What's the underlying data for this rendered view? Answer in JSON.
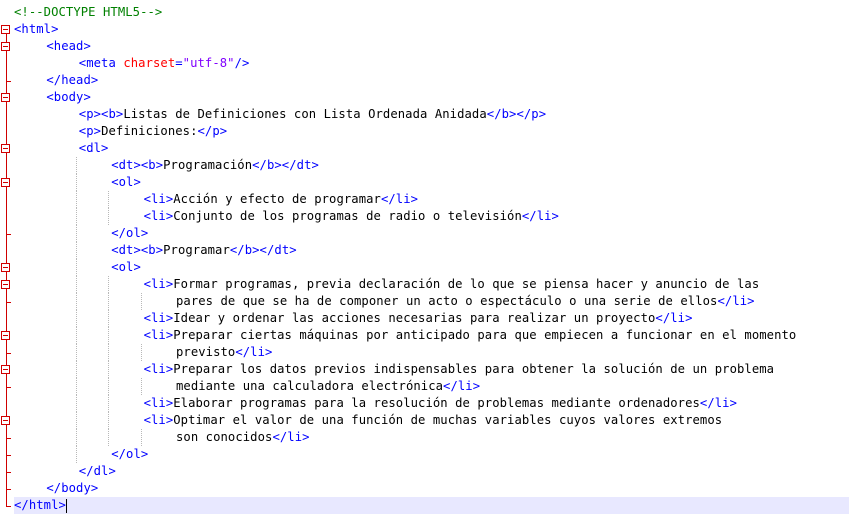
{
  "editor": {
    "language": "html",
    "current_line": 30,
    "lines": [
      {
        "n": 1,
        "indent": 0,
        "tokens": [
          {
            "t": "cmt",
            "v": "<!--DOCTYPE HTML5-->"
          }
        ]
      },
      {
        "n": 2,
        "indent": 0,
        "tokens": [
          {
            "t": "tag",
            "v": "<html>"
          }
        ]
      },
      {
        "n": 3,
        "indent": 1,
        "tokens": [
          {
            "t": "tag",
            "v": "<head>"
          }
        ]
      },
      {
        "n": 4,
        "indent": 2,
        "tokens": [
          {
            "t": "tag",
            "v": "<meta "
          },
          {
            "t": "attr",
            "v": "charset"
          },
          {
            "t": "tag",
            "v": "="
          },
          {
            "t": "val",
            "v": "\"utf-8\""
          },
          {
            "t": "tag",
            "v": "/>"
          }
        ]
      },
      {
        "n": 5,
        "indent": 1,
        "tokens": [
          {
            "t": "tag",
            "v": "</head>"
          }
        ]
      },
      {
        "n": 6,
        "indent": 1,
        "tokens": [
          {
            "t": "tag",
            "v": "<body>"
          }
        ]
      },
      {
        "n": 7,
        "indent": 2,
        "tokens": [
          {
            "t": "tag",
            "v": "<p><b>"
          },
          {
            "t": "txt",
            "v": "Listas de Definiciones con Lista Ordenada Anidada"
          },
          {
            "t": "tag",
            "v": "</b></p>"
          }
        ]
      },
      {
        "n": 8,
        "indent": 2,
        "tokens": [
          {
            "t": "tag",
            "v": "<p>"
          },
          {
            "t": "txt",
            "v": "Definiciones:"
          },
          {
            "t": "tag",
            "v": "</p>"
          }
        ]
      },
      {
        "n": 9,
        "indent": 2,
        "tokens": [
          {
            "t": "tag",
            "v": "<dl>"
          }
        ]
      },
      {
        "n": 10,
        "indent": 3,
        "tokens": [
          {
            "t": "tag",
            "v": "<dt><b>"
          },
          {
            "t": "txt",
            "v": "Programación"
          },
          {
            "t": "tag",
            "v": "</b></dt>"
          }
        ]
      },
      {
        "n": 11,
        "indent": 3,
        "tokens": [
          {
            "t": "tag",
            "v": "<ol>"
          }
        ]
      },
      {
        "n": 12,
        "indent": 4,
        "tokens": [
          {
            "t": "tag",
            "v": "<li>"
          },
          {
            "t": "txt",
            "v": "Acción y efecto de programar"
          },
          {
            "t": "tag",
            "v": "</li>"
          }
        ]
      },
      {
        "n": 13,
        "indent": 4,
        "tokens": [
          {
            "t": "tag",
            "v": "<li>"
          },
          {
            "t": "txt",
            "v": "Conjunto de los programas de radio o televisión"
          },
          {
            "t": "tag",
            "v": "</li>"
          }
        ]
      },
      {
        "n": 14,
        "indent": 3,
        "tokens": [
          {
            "t": "tag",
            "v": "</ol>"
          }
        ]
      },
      {
        "n": 15,
        "indent": 3,
        "tokens": [
          {
            "t": "tag",
            "v": "<dt><b>"
          },
          {
            "t": "txt",
            "v": "Programar"
          },
          {
            "t": "tag",
            "v": "</b></dt>"
          }
        ]
      },
      {
        "n": 16,
        "indent": 3,
        "tokens": [
          {
            "t": "tag",
            "v": "<ol>"
          }
        ]
      },
      {
        "n": 17,
        "indent": 4,
        "tokens": [
          {
            "t": "tag",
            "v": "<li>"
          },
          {
            "t": "txt",
            "v": "Formar programas, previa declaración de lo que se piensa hacer y anuncio de las"
          }
        ]
      },
      {
        "n": 18,
        "indent": 5,
        "tokens": [
          {
            "t": "txt",
            "v": "pares de que se ha de componer un acto o espectáculo o una serie de ellos"
          },
          {
            "t": "tag",
            "v": "</li>"
          }
        ]
      },
      {
        "n": 19,
        "indent": 4,
        "tokens": [
          {
            "t": "tag",
            "v": "<li>"
          },
          {
            "t": "txt",
            "v": "Idear y ordenar las acciones necesarias para realizar un proyecto"
          },
          {
            "t": "tag",
            "v": "</li>"
          }
        ]
      },
      {
        "n": 20,
        "indent": 4,
        "tokens": [
          {
            "t": "tag",
            "v": "<li>"
          },
          {
            "t": "txt",
            "v": "Preparar ciertas máquinas por anticipado para que empiecen a funcionar en el momento"
          }
        ]
      },
      {
        "n": 21,
        "indent": 5,
        "tokens": [
          {
            "t": "txt",
            "v": "previsto"
          },
          {
            "t": "tag",
            "v": "</li>"
          }
        ]
      },
      {
        "n": 22,
        "indent": 4,
        "tokens": [
          {
            "t": "tag",
            "v": "<li>"
          },
          {
            "t": "txt",
            "v": "Preparar los datos previos indispensables para obtener la solución de un problema"
          }
        ]
      },
      {
        "n": 23,
        "indent": 5,
        "tokens": [
          {
            "t": "txt",
            "v": "mediante una calculadora electrónica"
          },
          {
            "t": "tag",
            "v": "</li>"
          }
        ]
      },
      {
        "n": 24,
        "indent": 4,
        "tokens": [
          {
            "t": "tag",
            "v": "<li>"
          },
          {
            "t": "txt",
            "v": "Elaborar programas para la resolución de problemas mediante ordenadores"
          },
          {
            "t": "tag",
            "v": "</li>"
          }
        ]
      },
      {
        "n": 25,
        "indent": 4,
        "tokens": [
          {
            "t": "tag",
            "v": "<li>"
          },
          {
            "t": "txt",
            "v": "Optimar el valor de una función de muchas variables cuyos valores extremos"
          }
        ]
      },
      {
        "n": 26,
        "indent": 5,
        "tokens": [
          {
            "t": "txt",
            "v": "son conocidos"
          },
          {
            "t": "tag",
            "v": "</li>"
          }
        ]
      },
      {
        "n": 27,
        "indent": 3,
        "tokens": [
          {
            "t": "tag",
            "v": "</ol>"
          }
        ]
      },
      {
        "n": 28,
        "indent": 2,
        "tokens": [
          {
            "t": "tag",
            "v": "</dl>"
          }
        ]
      },
      {
        "n": 29,
        "indent": 1,
        "tokens": [
          {
            "t": "tag",
            "v": "</body>"
          }
        ]
      },
      {
        "n": 30,
        "indent": 0,
        "tokens": [
          {
            "t": "tag",
            "v": "</html>"
          }
        ]
      }
    ]
  },
  "colors": {
    "tag": "#0000ff",
    "attribute": "#ff0000",
    "value": "#8000ff",
    "comment": "#008000",
    "text": "#000000",
    "fold_marker": "#d00000",
    "current_line": "#e8e8ff"
  },
  "icons": {
    "fold_marker": "fold-minus-icon"
  }
}
